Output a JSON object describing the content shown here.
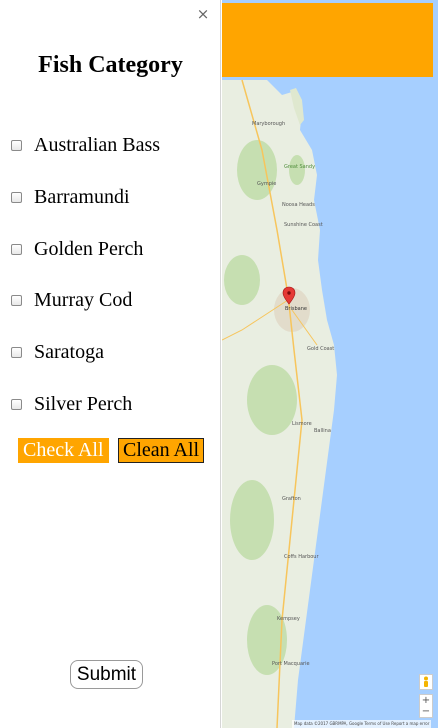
{
  "panel": {
    "close_label": "×",
    "title": "Fish Category",
    "options": [
      {
        "label": "Australian Bass",
        "checked": false
      },
      {
        "label": "Barramundi",
        "checked": false
      },
      {
        "label": "Golden Perch",
        "checked": false
      },
      {
        "label": "Murray Cod",
        "checked": false
      },
      {
        "label": "Saratoga",
        "checked": false
      },
      {
        "label": "Silver Perch",
        "checked": false
      }
    ],
    "check_all_label": "Check All",
    "clean_all_label": "Clean All",
    "submit_label": "Submit"
  },
  "map": {
    "labels": [
      "Maryborough",
      "Great Sandy National Park",
      "Gympie",
      "Noosa Heads",
      "Sunshine Coast",
      "Brisbane",
      "Gold Coast",
      "Lismore",
      "Ballina",
      "Grafton",
      "Coffs Harbour",
      "Kempsey",
      "Port Macquarie"
    ],
    "attribution": "Map data ©2017 GBRMPA, Google   Terms of Use   Report a map error",
    "zoom_in": "+",
    "zoom_out": "−",
    "colors": {
      "water": "#a6cfff",
      "land": "#e8eee0",
      "topbar": "#ffa500"
    }
  }
}
